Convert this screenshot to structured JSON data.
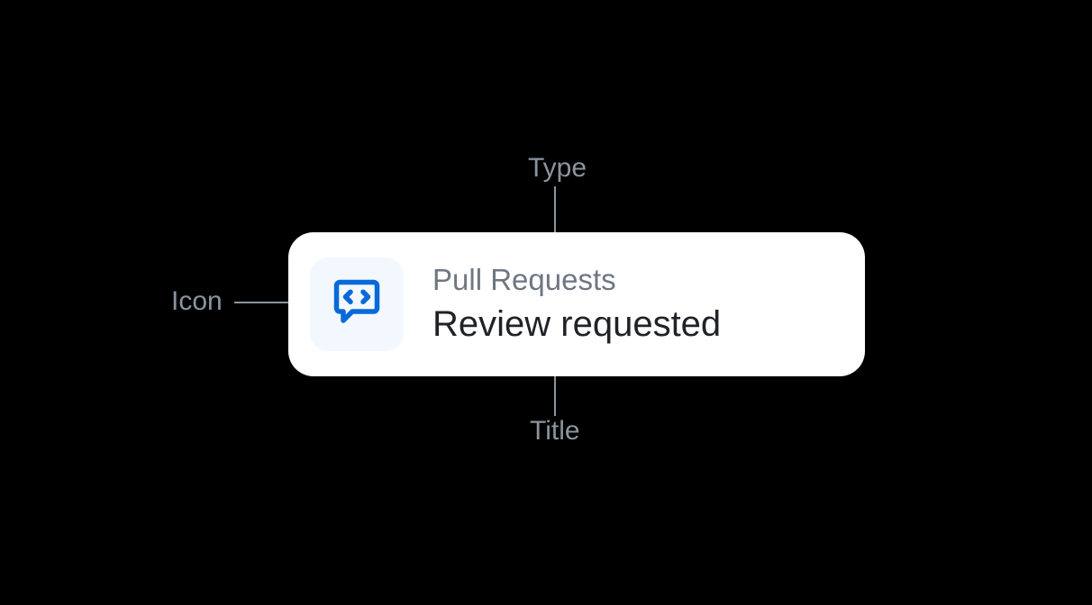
{
  "annotations": {
    "type": "Type",
    "title": "Title",
    "icon": "Icon"
  },
  "card": {
    "type": "Pull Requests",
    "title": "Review requested",
    "icon_name": "code-review-icon"
  }
}
